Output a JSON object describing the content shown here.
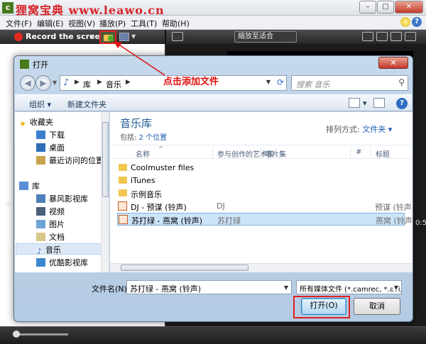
{
  "app": {
    "title": "狸窝宝典 www.leawo.cn",
    "window_buttons": [
      "–",
      "□",
      "✕"
    ],
    "menu": [
      "文件(F)",
      "编辑(E)",
      "视图(V)",
      "播放(P)",
      "工具(T)",
      "帮助(H)"
    ],
    "help_q": "?",
    "toolbar": {
      "record_label": "Record the screen",
      "zoom_value": "缩放至适合"
    },
    "left_glimpse": "0:",
    "right_glimpse": "0:5"
  },
  "annotation": {
    "text": "点击添加文件",
    "color": "#e01010"
  },
  "dialog": {
    "title": "打开",
    "close": "✕",
    "address": {
      "crumbs": [
        "库",
        "音乐"
      ]
    },
    "search_placeholder": "搜索 音乐",
    "commands": {
      "organize": "组织 ▾",
      "new_folder": "新建文件夹",
      "help": "?"
    },
    "nav": {
      "favorites_header": "收藏夹",
      "favorites": [
        "下载",
        "桌面",
        "最近访问的位置"
      ],
      "libraries_header": "库",
      "libraries": [
        "暴风影视库",
        "视频",
        "图片",
        "文档",
        "音乐",
        "优酷影视库"
      ],
      "selected": "音乐"
    },
    "library": {
      "title": "音乐库",
      "includes_label": "包括:",
      "includes_link": "2 个位置",
      "arrange_label": "排列方式:",
      "arrange_value": "文件夹 ▾"
    },
    "columns": [
      "名称",
      "参与创作的艺术家",
      "唱片集",
      "#",
      "标题"
    ],
    "rows": [
      {
        "name": "Coolmuster files",
        "artist": "",
        "tag": "",
        "type": "folder"
      },
      {
        "name": "iTunes",
        "artist": "",
        "tag": "",
        "type": "folder"
      },
      {
        "name": "示例音乐",
        "artist": "",
        "tag": "",
        "type": "folder"
      },
      {
        "name": "DJ - 预谋 (铃声)",
        "artist": "DJ",
        "tag": "预谋 (铃声)",
        "type": "media"
      },
      {
        "name": "苏打绿 - 燕窝 (铃声)",
        "artist": "苏打绿",
        "tag": "燕窝 (铃声)",
        "type": "media",
        "selected": true
      }
    ],
    "filename_label": "文件名(N):",
    "filename_value": "苏打绿 - 燕窝 (铃声)",
    "filetype_value": "所有媒体文件 (*.camrec, *.avi,",
    "open_button": "打开(O)",
    "cancel_button": "取消"
  },
  "colors": {
    "highlight_red": "#e02020",
    "library_title": "#1e5a96",
    "link_blue": "#1c5cb0"
  }
}
